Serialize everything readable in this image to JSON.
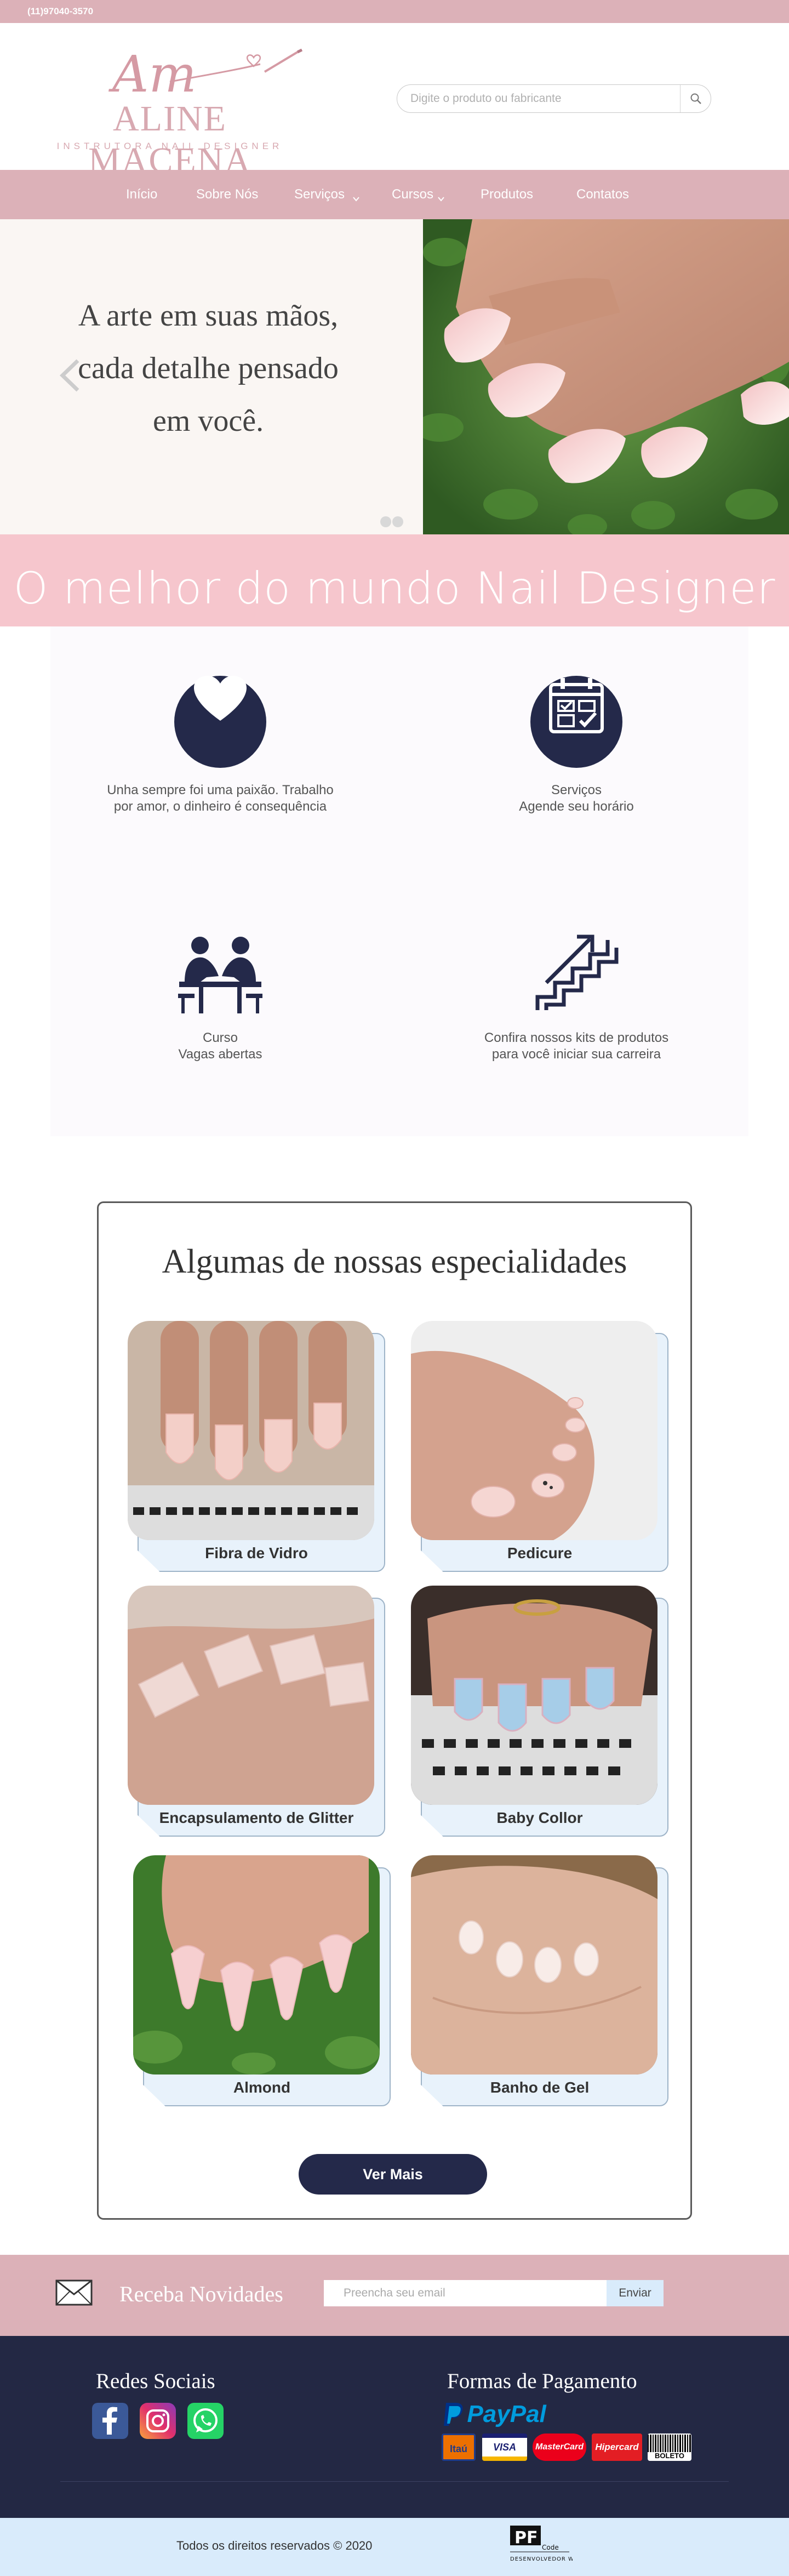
{
  "topbar": {
    "phone": "(11)97040-3570"
  },
  "logo": {
    "monogram": "Am",
    "brand": "ALINE MACENA",
    "tagline": "INSTRUTORA NAIL DESIGNER"
  },
  "search": {
    "placeholder": "Digite o produto ou fabricante",
    "icon": "search-icon"
  },
  "nav": {
    "items": [
      {
        "label": "Início"
      },
      {
        "label": "Sobre Nós"
      },
      {
        "label": "Serviços",
        "dropdown": true
      },
      {
        "label": "Cursos",
        "dropdown": true
      },
      {
        "label": "Produtos"
      },
      {
        "label": "Contatos"
      }
    ]
  },
  "hero": {
    "lines": [
      "A arte em suas mãos,",
      "cada detalhe pensado",
      "em você."
    ],
    "slides": 2,
    "active_slide": 1
  },
  "slogan": "O melhor do mundo Nail Designer",
  "features": [
    {
      "icon": "heart-icon",
      "lines": [
        "Unha sempre foi uma paixão. Trabalho",
        "por amor, o dinheiro é consequência"
      ]
    },
    {
      "icon": "calendar-check-icon",
      "lines": [
        "Serviços",
        "Agende seu horário"
      ]
    },
    {
      "icon": "course-people-icon",
      "lines": [
        "Curso",
        "Vagas abertas"
      ]
    },
    {
      "icon": "growth-stairs-icon",
      "lines": [
        "Confira nossos kits de produtos",
        "para você iniciar sua carreira"
      ]
    }
  ],
  "specialties": {
    "title": "Algumas de nossas especialidades",
    "items": [
      {
        "label": "Fibra de Vidro"
      },
      {
        "label": "Pedicure"
      },
      {
        "label": "Encapsulamento de Glitter"
      },
      {
        "label": "Baby Collor"
      },
      {
        "label": "Almond"
      },
      {
        "label": "Banho de Gel"
      }
    ],
    "more": "Ver Mais"
  },
  "newsletter": {
    "label": "Receba Novidades",
    "placeholder": "Preencha seu email",
    "button": "Enviar"
  },
  "footer": {
    "social_title": "Redes Sociais",
    "payment_title": "Formas de Pagamento",
    "paypal": "PayPal",
    "cards": [
      "Itaú",
      "VISA",
      "MasterCard",
      "Hipercard",
      "BOLETO"
    ],
    "copyright": "Todos os direitos reservados © 2020",
    "developer": "DESENVOLVEDOR WEB",
    "developer_logo": "PF",
    "developer_logo_sub": "Code"
  },
  "colors": {
    "rose": "#dcb1b8",
    "pink": "#f6c6cd",
    "navy": "#232844",
    "light_blue": "#d9ebfb"
  }
}
